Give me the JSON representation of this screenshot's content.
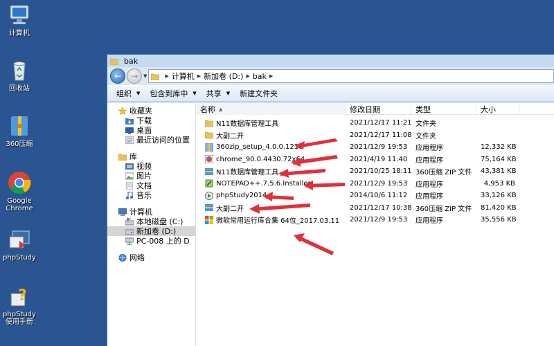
{
  "desktop": {
    "icons": [
      {
        "label": "计算机",
        "icon": "computer-icon"
      },
      {
        "label": "回收站",
        "icon": "recycle-bin-icon"
      },
      {
        "label": "360压缩",
        "icon": "archive-360-icon"
      },
      {
        "label": "Google Chrome",
        "icon": "chrome-icon"
      },
      {
        "label": "phpStudy",
        "icon": "phpstudy-icon"
      },
      {
        "label": "phpStudy使用手册",
        "icon": "help-icon"
      }
    ]
  },
  "window": {
    "title": "bak",
    "address": {
      "segments": [
        "计算机",
        "新加卷 (D:)",
        "bak"
      ]
    },
    "toolbar": {
      "organize": "组织",
      "include_library": "包含到库中",
      "share": "共享",
      "new_folder": "新建文件夹"
    },
    "navpane": {
      "favorites": {
        "label": "收藏夹",
        "items": [
          "下载",
          "桌面",
          "最近访问的位置"
        ]
      },
      "libraries": {
        "label": "库",
        "items": [
          "视频",
          "图片",
          "文档",
          "音乐"
        ]
      },
      "computer": {
        "label": "计算机",
        "items": [
          "本地磁盘 (C:)",
          "新加卷 (D:)",
          "PC-008 上的 D"
        ]
      },
      "network": {
        "label": "网络"
      }
    },
    "columns": {
      "name": "名称",
      "date": "修改日期",
      "type": "类型",
      "size": "大小"
    },
    "files": [
      {
        "name": "N11数据库管理工具",
        "date": "2021/12/17 11:21",
        "type": "文件夹",
        "size": "",
        "icon": "folder-icon"
      },
      {
        "name": "大副二开",
        "date": "2021/12/17 11:08",
        "type": "文件夹",
        "size": "",
        "icon": "folder-icon"
      },
      {
        "name": "360zip_setup_4.0.0.1210",
        "date": "2021/12/9 19:53",
        "type": "应用程序",
        "size": "12,332 KB",
        "icon": "installer-icon"
      },
      {
        "name": "chrome_90.0.4430.72x64",
        "date": "2021/4/19 11:40",
        "type": "应用程序",
        "size": "75,164 KB",
        "icon": "chrome-setup-icon"
      },
      {
        "name": "N11数据库管理工具",
        "date": "2021/10/25 18:11",
        "type": "360压缩 ZIP 文件",
        "size": "43,381 KB",
        "icon": "zip-icon"
      },
      {
        "name": "NOTEPAD++.7.5.6.Installer",
        "date": "2021/12/9 19:53",
        "type": "应用程序",
        "size": "4,953 KB",
        "icon": "notepad-icon"
      },
      {
        "name": "phpStudy2014",
        "date": "2014/10/6 11:12",
        "type": "应用程序",
        "size": "33,126 KB",
        "icon": "phpstudy-icon"
      },
      {
        "name": "大副二开",
        "date": "2021/12/17 10:38",
        "type": "360压缩 ZIP 文件",
        "size": "81,420 KB",
        "icon": "zip-icon"
      },
      {
        "name": "微软常用运行库合集 64位_2017.03.11",
        "date": "2021/12/9 19:53",
        "type": "应用程序",
        "size": "35,556 KB",
        "icon": "windows-icon"
      }
    ]
  },
  "colors": {
    "desktop": "#2a5592",
    "annotation_arrow": "#e0303a",
    "folder": "#e8c25a"
  }
}
